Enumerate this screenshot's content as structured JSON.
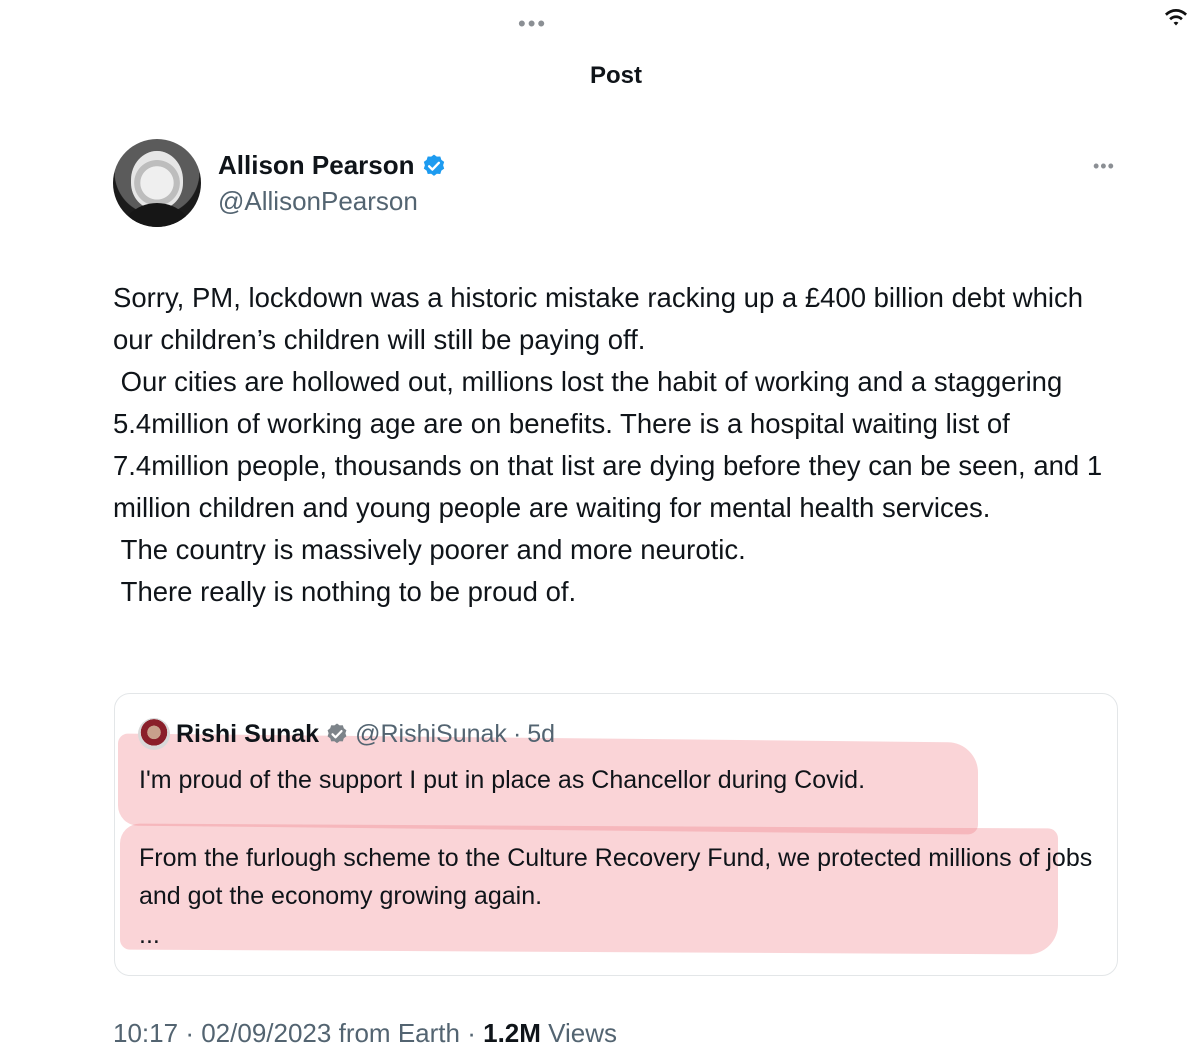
{
  "header": {
    "title": "Post"
  },
  "post": {
    "author_name": "Allison Pearson",
    "author_handle": "@AllisonPearson",
    "body": "Sorry, PM, lockdown was a historic mistake racking up a £400 billion debt which our children’s children will still be paying off.\n Our cities are hollowed out, millions lost the habit of working and a staggering 5.4million of working age are on benefits. There is a hospital waiting list of 7.4million people, thousands on that list are dying before they can be seen, and 1 million children and young people are waiting for mental health services.\n The country is massively poorer and more neurotic.\n There really is nothing to be proud of.",
    "time": "10:17",
    "date": "02/09/2023",
    "source": "from Earth",
    "views_count": "1.2M",
    "views_label": "Views"
  },
  "quote": {
    "author_name": "Rishi Sunak",
    "author_handle": "@RishiSunak",
    "age": "5d",
    "line1": "I'm proud of the support I put in place as Chancellor during Covid.",
    "line2": "From the furlough scheme to the Culture Recovery Fund, we protected millions of jobs and got the economy growing again.",
    "line3": "..."
  },
  "icons": {
    "top_dots": "more-dots-icon",
    "wifi": "wifi-icon",
    "verified": "verified-badge-icon",
    "more": "more-options-icon"
  },
  "colors": {
    "verified_blue": "#1d9bf0",
    "highlight": "#f07882",
    "secondary_text": "#536471"
  }
}
